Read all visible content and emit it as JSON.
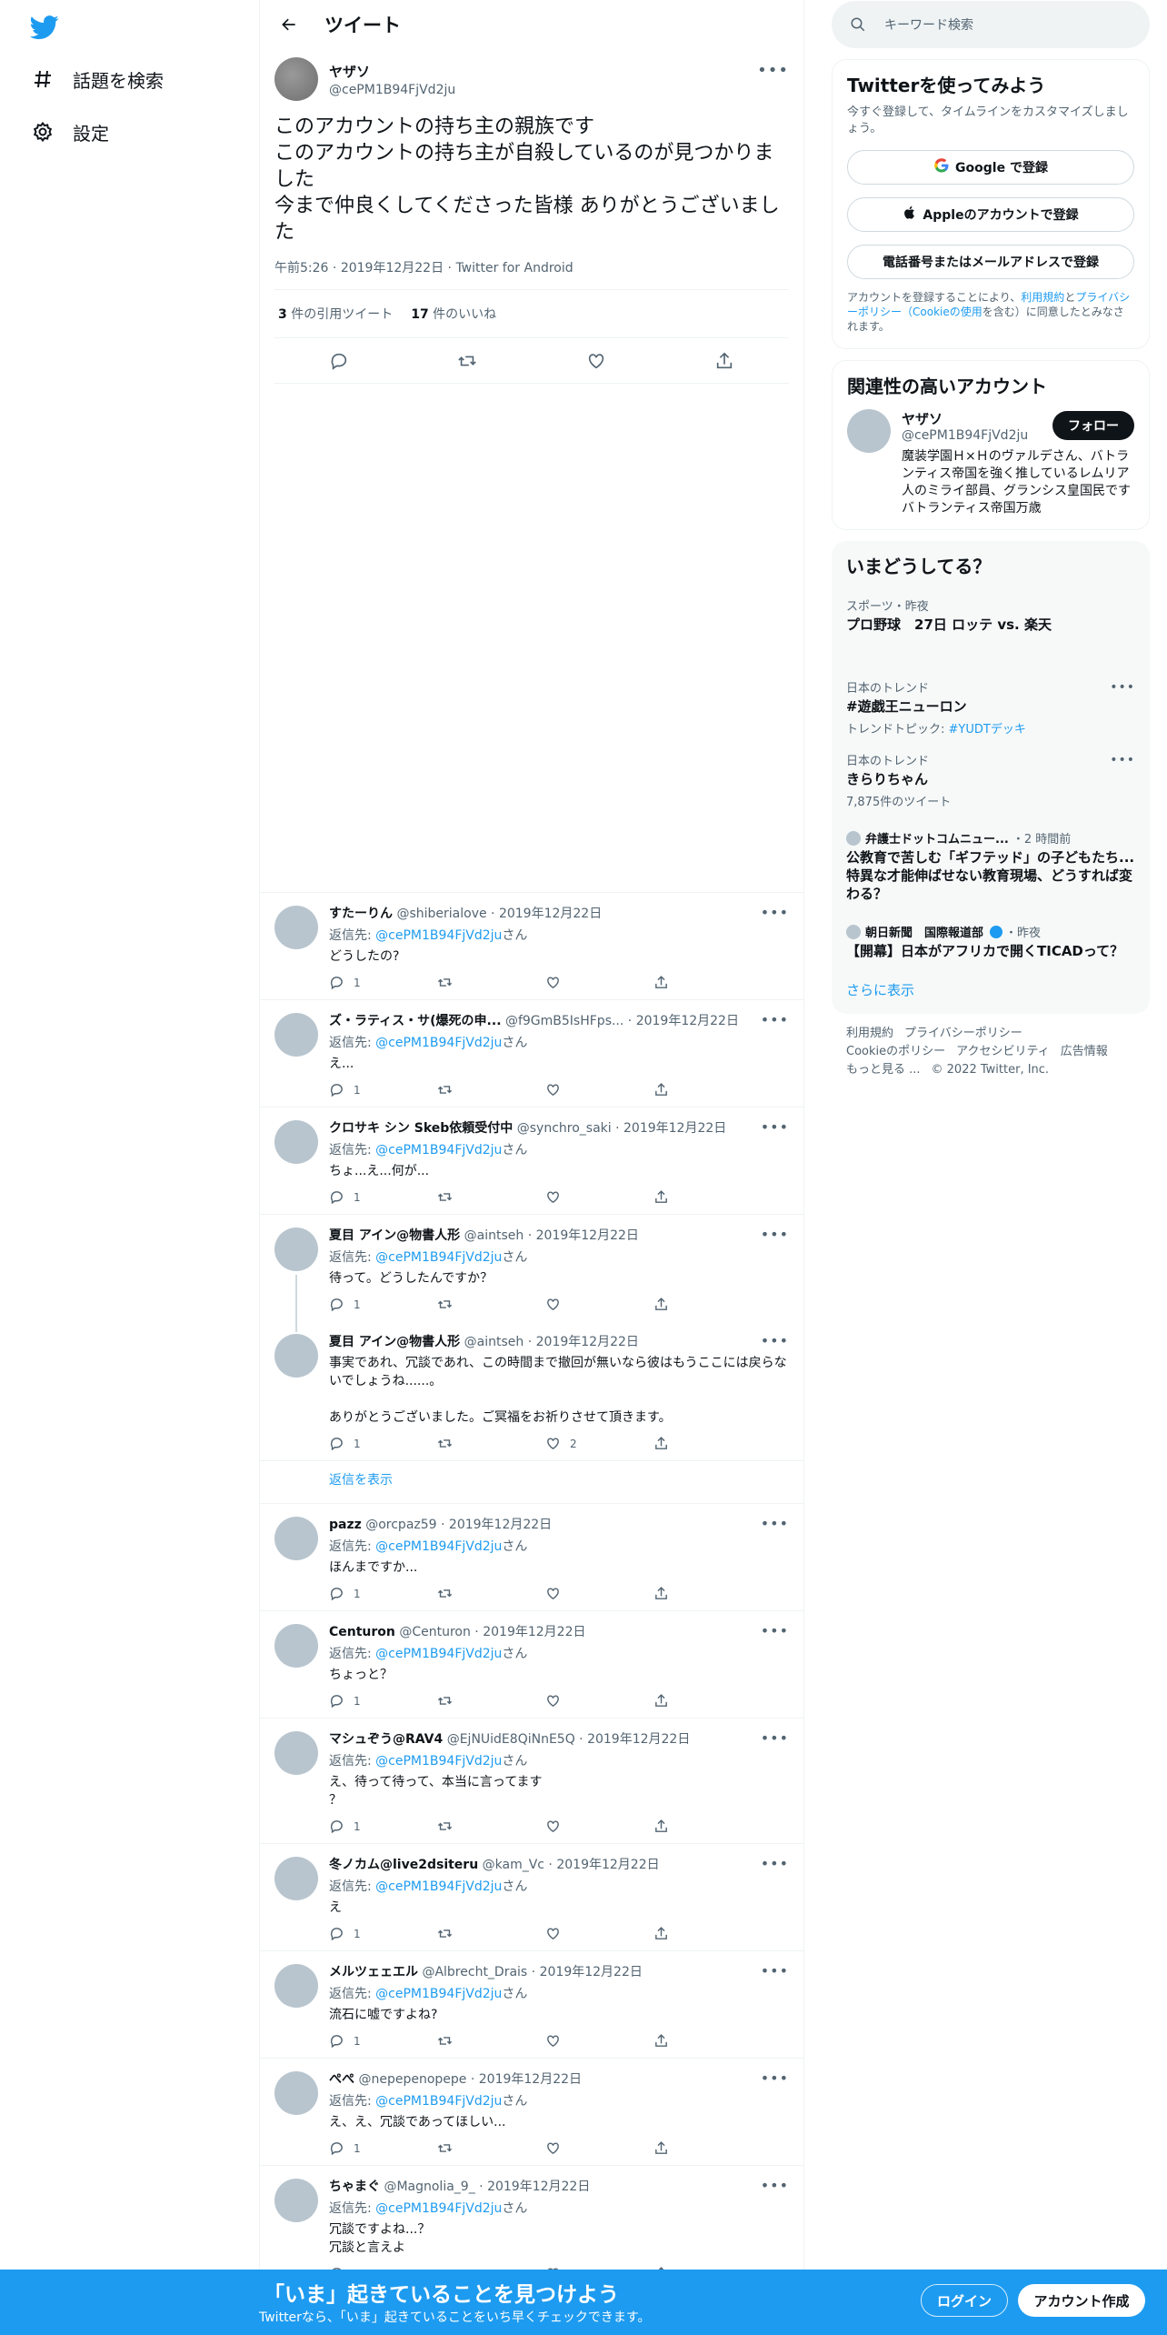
{
  "nav": {
    "items": [
      {
        "label": "話題を検索",
        "icon": "hashtag-icon"
      },
      {
        "label": "設定",
        "icon": "gear-icon"
      }
    ]
  },
  "header": {
    "title": "ツイート"
  },
  "tweet": {
    "name": "ヤザソ",
    "handle": "@cePM1B94FjVd2ju",
    "lines": [
      "このアカウントの持ち主の親族です",
      "このアカウントの持ち主が自殺しているのが見つかりました",
      "今まで仲良くしてくださった皆様 ありがとうございました"
    ],
    "time": "午前5:26",
    "date": "2019年12月22日",
    "source": "Twitter for Android",
    "quote_count": "3",
    "quote_label": "件の引用ツイート",
    "like_count": "17",
    "like_label": "件のいいね"
  },
  "reply_prefix": "返信先:",
  "reply_to": "@cePM1B94FjVd2ju",
  "reply_suffix": "さん",
  "replies": [
    {
      "name": "すたーりん",
      "handle": "@shiberialove",
      "date": "2019年12月22日",
      "text": "どうしたの?",
      "reply_count": "1",
      "like_count": ""
    },
    {
      "name": "ズ・ラティス・サ(爆死の申...",
      "handle": "@f9GmB5IsHFps...",
      "date": "2019年12月22日",
      "text": "え...",
      "reply_count": "1",
      "like_count": ""
    },
    {
      "name": "クロサキ シン Skeb依頼受付中",
      "handle": "@synchro_saki",
      "date": "2019年12月22日",
      "text": "ちょ...え...何が...",
      "reply_count": "1",
      "like_count": ""
    },
    {
      "name": "夏目 アイン@物書人形",
      "handle": "@aintseh",
      "date": "2019年12月22日",
      "text": "待って。どうしたんですか？",
      "reply_count": "1",
      "like_count": ""
    },
    {
      "name": "夏目 アイン@物書人形",
      "handle": "@aintseh",
      "date": "2019年12月22日",
      "text": "事実であれ、冗談であれ、この時間まで撤回が無いなら彼はもうここには戻らないでしょうね......。\n\nありがとうございました。ご冥福をお祈りさせて頂きます。",
      "reply_count": "1",
      "like_count": "2"
    },
    {
      "name": "pazz",
      "handle": "@orcpaz59",
      "date": "2019年12月22日",
      "text": "ほんまですか...",
      "reply_count": "1",
      "like_count": ""
    },
    {
      "name": "Centuron",
      "handle": "@Centuron",
      "date": "2019年12月22日",
      "text": "ちょっと？",
      "reply_count": "1",
      "like_count": ""
    },
    {
      "name": "マシュぞう@RAV4",
      "handle": "@EjNUidE8QiNnE5Q",
      "date": "2019年12月22日",
      "text": "え、待って待って、本当に言ってます\n？",
      "reply_count": "1",
      "like_count": ""
    },
    {
      "name": "冬ノカム@live2dsiteru",
      "handle": "@kam_Vc",
      "date": "2019年12月22日",
      "text": "え",
      "reply_count": "1",
      "like_count": ""
    },
    {
      "name": "メルツェェエル",
      "handle": "@Albrecht_Drais",
      "date": "2019年12月22日",
      "text": "流石に嘘ですよね?",
      "reply_count": "1",
      "like_count": ""
    },
    {
      "name": "ぺぺ",
      "handle": "@nepepenopepe",
      "date": "2019年12月22日",
      "text": "え、え、冗談であってほしい...",
      "reply_count": "1",
      "like_count": ""
    },
    {
      "name": "ちゃまぐ",
      "handle": "@Magnolia_9_",
      "date": "2019年12月22日",
      "text": "冗談ですよね...？\n冗談と言えよ",
      "reply_count": "",
      "like_count": ""
    }
  ],
  "show_replies": "返信を表示",
  "search": {
    "placeholder": "キーワード検索"
  },
  "signup": {
    "title": "Twitterを使ってみよう",
    "desc": "今すぐ登録して、タイムラインをカスタマイズしましょう。",
    "google": "Google で登録",
    "apple": "Appleのアカウントで登録",
    "phone": "電話番号またはメールアドレスで登録",
    "terms_1": "アカウントを登録することにより、",
    "terms_link1": "利用規約",
    "terms_2": "と",
    "terms_link2": "プライバシーポリシー（Cookieの使用",
    "terms_3": "を含む）に同意したとみなされます。"
  },
  "related": {
    "title": "関連性の高いアカウント",
    "name": "ヤザソ",
    "handle": "@cePM1B94FjVd2ju",
    "follow": "フォロー",
    "bio": "魔装学園Ｈ×Ｈのヴァルデさん、バトランティス帝国を強く推しているレムリア人のミライ部員、グランシス皇国民です　　　バトランティス帝国万歳"
  },
  "trends": {
    "title": "いまどうしてる？",
    "items": [
      {
        "context": "スポーツ・昨夜",
        "title": "プロ野球　27日 ロッテ vs. 楽天",
        "sub": "",
        "sub_link": ""
      },
      {
        "context": "日本のトレンド",
        "title": "#遊戯王ニューロン",
        "sub": "トレンドトピック: ",
        "sub_link": "#YUDTデッキ"
      },
      {
        "context": "日本のトレンド",
        "title": "きらりちゃん",
        "sub": "7,875件のツイート",
        "sub_link": ""
      }
    ],
    "news": [
      {
        "source": "弁護士ドットコムニュー...",
        "time": "・2 時間前",
        "title": "公教育で苦しむ「ギフテッド」の子どもたち...特異な才能伸ばせない教育現場、どうすれば変わる？"
      },
      {
        "source": "朝日新聞　国際報道部",
        "time": "・昨夜",
        "title": "【開幕】日本がアフリカで開くTICADって？"
      }
    ],
    "show_more": "さらに表示"
  },
  "footer": {
    "links": [
      "利用規約",
      "プライバシーポリシー",
      "Cookieのポリシー",
      "アクセシビリティ",
      "広告情報",
      "もっと見る ...",
      "© 2022 Twitter, Inc."
    ]
  },
  "bottom": {
    "title": "「いま」起きていることを見つけよう",
    "sub": "Twitterなら、「いま」起きていることをいち早くチェックできます。",
    "login": "ログイン",
    "create": "アカウント作成"
  },
  "colors": {
    "accent": "#1d9bf0",
    "text": "#0f1419",
    "muted": "#536471"
  }
}
